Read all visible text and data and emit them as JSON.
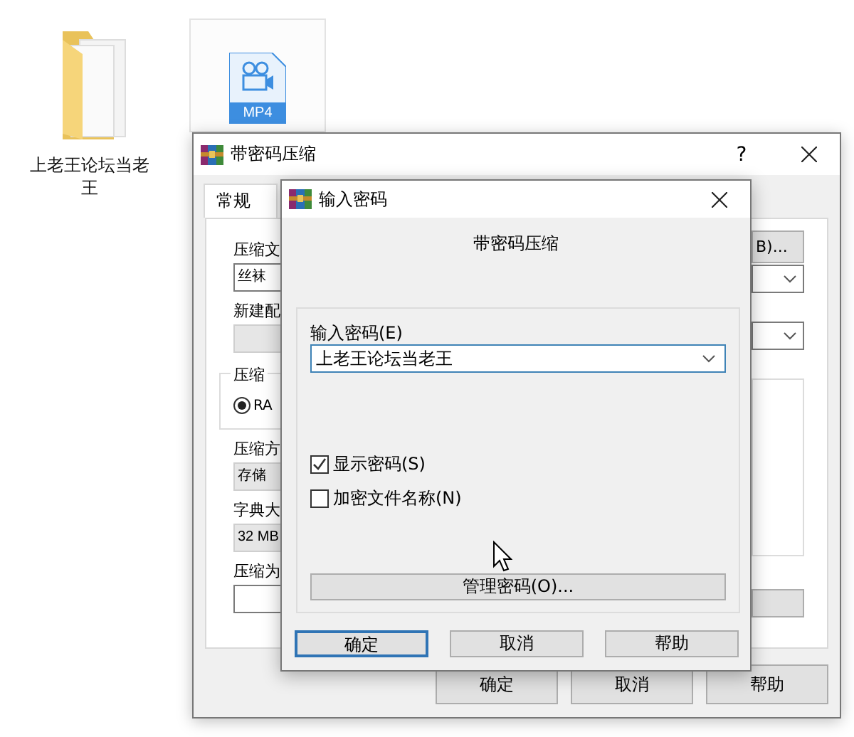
{
  "desktop": {
    "icons": [
      {
        "kind": "folder",
        "label": "上老王论坛当老王",
        "selected": false
      },
      {
        "kind": "video",
        "badge": "MP4",
        "selected": true
      }
    ]
  },
  "back_window": {
    "title": "带密码压缩",
    "help": "?",
    "tabs": [
      {
        "label": "常规",
        "selected": true
      }
    ],
    "left_items": [
      {
        "kind": "label",
        "text": "压缩文"
      },
      {
        "kind": "field",
        "value": "丝袜"
      },
      {
        "kind": "label",
        "text": "新建配"
      },
      {
        "kind": "combo"
      },
      {
        "kind": "group",
        "legend": "压缩",
        "options": [
          {
            "label": "RA",
            "selected": true
          }
        ]
      },
      {
        "kind": "label",
        "text": "压缩方"
      },
      {
        "kind": "combo",
        "value": "存储"
      },
      {
        "kind": "label",
        "text": "字典大"
      },
      {
        "kind": "combo",
        "value": "32 MB"
      },
      {
        "kind": "label",
        "text": "压缩为"
      },
      {
        "kind": "field"
      }
    ],
    "right_items": [
      {
        "kind": "button",
        "label": "B)..."
      },
      {
        "kind": "combo"
      },
      {
        "kind": "combo"
      },
      {
        "kind": "group"
      },
      {
        "kind": "button"
      }
    ],
    "buttons": [
      "确定",
      "取消",
      "帮助"
    ]
  },
  "dialog": {
    "title": "输入密码",
    "heading": "带密码压缩",
    "password_label": "输入密码(E)",
    "password": "上老王论坛当老王",
    "checkboxes": [
      {
        "label": "显示密码(S)",
        "checked": true
      },
      {
        "label": "加密文件名称(N)",
        "checked": false
      }
    ],
    "manage_button": "管理密码(O)...",
    "buttons": [
      {
        "label": "确定",
        "default": true
      },
      {
        "label": "取消",
        "default": false
      },
      {
        "label": "帮助",
        "default": false
      }
    ]
  }
}
